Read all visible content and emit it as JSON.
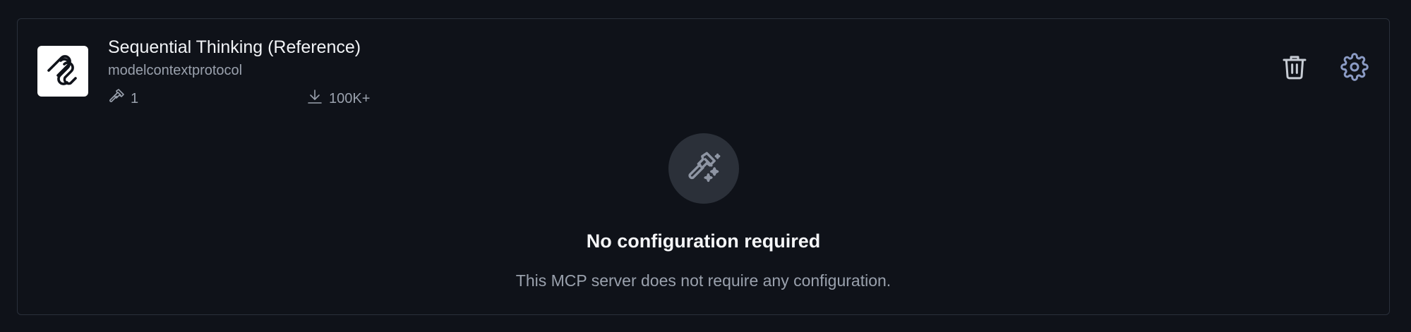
{
  "server": {
    "title": "Sequential Thinking (Reference)",
    "publisher": "modelcontextprotocol",
    "tools_count": "1",
    "downloads": "100K+",
    "logo_icon": "mcp-logo-icon"
  },
  "actions": {
    "delete_icon": "trash-icon",
    "settings_icon": "gear-icon"
  },
  "empty_state": {
    "icon": "tools-sparkle-icon",
    "title": "No configuration required",
    "subtitle": "This MCP server does not require any configuration."
  },
  "colors": {
    "background": "#0f1219",
    "border": "#2a303b",
    "text_primary": "#f1f3f6",
    "text_muted": "#9aa1ad",
    "badge_bg": "#2b3039",
    "icon_gray": "#c7ccd4",
    "icon_blue_gray": "#8b9bc4"
  }
}
